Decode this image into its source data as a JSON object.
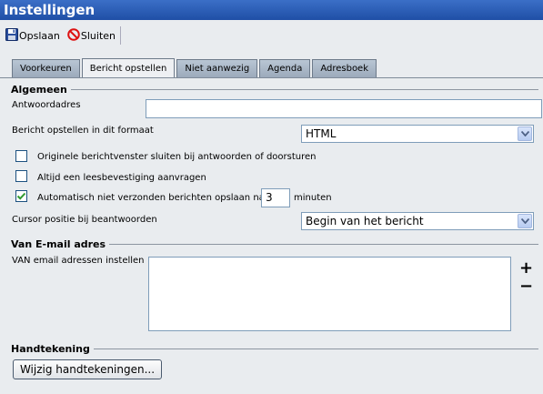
{
  "window": {
    "title": "Instellingen"
  },
  "toolbar": {
    "save_label": "Opslaan",
    "close_label": "Sluiten"
  },
  "tabs": [
    {
      "label": "Voorkeuren",
      "active": false
    },
    {
      "label": "Bericht opstellen",
      "active": true
    },
    {
      "label": "Niet aanwezig",
      "active": false
    },
    {
      "label": "Agenda",
      "active": false
    },
    {
      "label": "Adresboek",
      "active": false
    }
  ],
  "general": {
    "heading": "Algemeen",
    "reply_address_label": "Antwoordadres",
    "reply_address_value": "",
    "format_label": "Bericht opstellen in dit formaat",
    "format_value": "HTML",
    "close_original_label": "Originele berichtvenster sluiten bij antwoorden of doorsturen",
    "close_original_checked": false,
    "read_receipt_label": "Altijd een leesbevestiging aanvragen",
    "read_receipt_checked": false,
    "autosave_label": "Automatisch niet verzonden berichten opslaan na:",
    "autosave_checked": true,
    "autosave_value": "3",
    "autosave_unit": "minuten",
    "cursor_label": "Cursor positie bij beantwoorden",
    "cursor_value": "Begin van het bericht"
  },
  "from_address": {
    "heading": "Van E-mail adres",
    "label": "VAN email adressen instellen",
    "add_symbol": "+",
    "remove_symbol": "−"
  },
  "signature": {
    "heading": "Handtekening",
    "button_label": "Wijzig handtekeningen..."
  },
  "icons": {
    "save": "floppy-disk-icon",
    "close": "no-entry-icon",
    "dropdown": "chevron-down-icon",
    "check": "checkmark-icon"
  },
  "colors": {
    "title_bar": "#2a5db4",
    "tab_inactive": "#a9b7c8",
    "check_green": "#2e9a2e",
    "close_red": "#d11"
  }
}
